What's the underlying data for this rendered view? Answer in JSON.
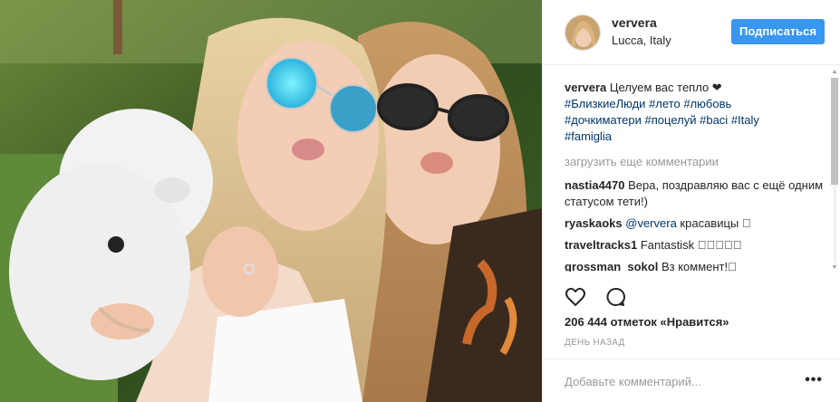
{
  "post": {
    "username": "ververa",
    "location": "Lucca, Italy",
    "follow_label": "Подписаться",
    "caption": {
      "username": "ververa",
      "text": "Целуем вас тепло ❤",
      "hashtags": [
        "#БлизкиеЛюди",
        "#лето",
        "#любовь",
        "#дочкиматери",
        "#поцелуй",
        "#baci",
        "#Italy",
        "#famiglia"
      ]
    },
    "load_more": "загрузить еще комментарии",
    "comments": [
      {
        "user": "nastia4470",
        "mention": "",
        "text": "Вера, поздравляю вас с ещё одним статусом тети!)"
      },
      {
        "user": "ryaskaoks",
        "mention": "@ververa",
        "text": "красавицы 􀀀"
      },
      {
        "user": "traveltracks1",
        "mention": "",
        "text": "Fantastisk 􀀀􀀀􀀀􀀀􀀀"
      },
      {
        "user": "grossman_sokol",
        "mention": "",
        "text": "Вз коммент!􀀀"
      }
    ],
    "likes_text": "206 444 отметок «Нравится»",
    "date_text": "ДЕНЬ НАЗАД",
    "add_comment_placeholder": "Добавьте комментарий...",
    "more_label": "•••"
  },
  "icons": [
    "heart-icon",
    "comment-icon"
  ],
  "colors": {
    "accent": "#3897f0",
    "hashtag": "#003569",
    "muted": "#999999"
  }
}
